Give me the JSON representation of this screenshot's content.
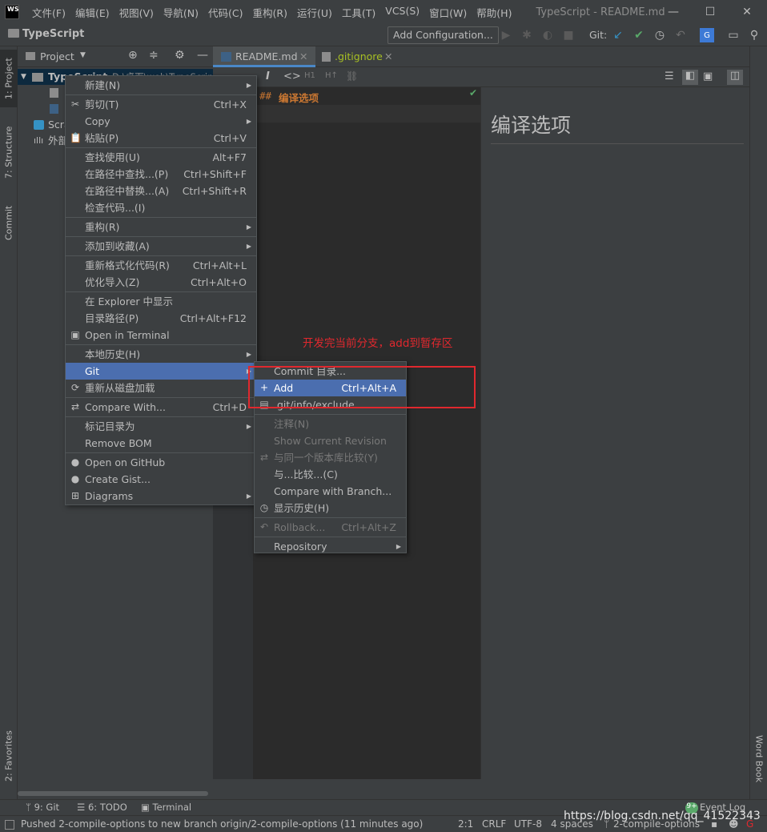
{
  "app": {
    "logo": "WS",
    "window_title": "TypeScript - README.md",
    "project_name": "TypeScript"
  },
  "menubar": [
    "文件(F)",
    "编辑(E)",
    "视图(V)",
    "导航(N)",
    "代码(C)",
    "重构(R)",
    "运行(U)",
    "工具(T)",
    "VCS(S)",
    "窗口(W)",
    "帮助(H)"
  ],
  "window_controls": {
    "minimize": "—",
    "maximize": "☐",
    "close": "✕"
  },
  "toolbar": {
    "add_configuration": "Add Configuration...",
    "git_label": "Git:"
  },
  "left_stripe": {
    "project": "1: Project",
    "structure": "7: Structure",
    "commit": "Commit",
    "favorites": "2: Favorites"
  },
  "right_stripe": {
    "word_book": "Word Book"
  },
  "project_panel": {
    "header": "Project",
    "root": "TypeScript",
    "root_path": "D:\\桌面\\web\\TypeScript",
    "scratches": "Scra",
    "external": "外部"
  },
  "tabs": [
    {
      "label": "README.md",
      "color": "#bbbbbb"
    },
    {
      "label": ".gitignore",
      "color": "#a8c023"
    }
  ],
  "editor": {
    "line1_hash": "##",
    "line1_text": "编译选项",
    "preview_title": "编译选项"
  },
  "context_menu": {
    "items": [
      {
        "label": "新建(N)",
        "shortcut": "",
        "submenu": true,
        "icon": ""
      },
      {
        "sep": true
      },
      {
        "label": "剪切(T)",
        "shortcut": "Ctrl+X",
        "icon": "✂"
      },
      {
        "label": "Copy",
        "shortcut": "",
        "submenu": true,
        "icon": ""
      },
      {
        "label": "粘贴(P)",
        "shortcut": "Ctrl+V",
        "icon": "📋"
      },
      {
        "sep": true
      },
      {
        "label": "查找使用(U)",
        "shortcut": "Alt+F7",
        "icon": ""
      },
      {
        "label": "在路径中查找...(P)",
        "shortcut": "Ctrl+Shift+F",
        "icon": ""
      },
      {
        "label": "在路径中替换...(A)",
        "shortcut": "Ctrl+Shift+R",
        "icon": ""
      },
      {
        "label": "检查代码...(I)",
        "shortcut": "",
        "icon": ""
      },
      {
        "sep": true
      },
      {
        "label": "重构(R)",
        "shortcut": "",
        "submenu": true,
        "icon": ""
      },
      {
        "sep": true
      },
      {
        "label": "添加到收藏(A)",
        "shortcut": "",
        "submenu": true,
        "icon": ""
      },
      {
        "sep": true
      },
      {
        "label": "重新格式化代码(R)",
        "shortcut": "Ctrl+Alt+L",
        "icon": ""
      },
      {
        "label": "优化导入(Z)",
        "shortcut": "Ctrl+Alt+O",
        "icon": ""
      },
      {
        "sep": true
      },
      {
        "label": "在 Explorer 中显示",
        "shortcut": "",
        "icon": ""
      },
      {
        "label": "目录路径(P)",
        "shortcut": "Ctrl+Alt+F12",
        "icon": ""
      },
      {
        "label": "Open in Terminal",
        "shortcut": "",
        "icon": "▣"
      },
      {
        "sep": true
      },
      {
        "label": "本地历史(H)",
        "shortcut": "",
        "submenu": true,
        "icon": ""
      },
      {
        "label": "Git",
        "shortcut": "",
        "submenu": true,
        "icon": "",
        "selected": true
      },
      {
        "label": "重新从磁盘加载",
        "shortcut": "",
        "icon": "⟳"
      },
      {
        "sep": true
      },
      {
        "label": "Compare With...",
        "shortcut": "Ctrl+D",
        "icon": "⇄"
      },
      {
        "sep": true
      },
      {
        "label": "标记目录为",
        "shortcut": "",
        "submenu": true,
        "icon": ""
      },
      {
        "label": "Remove BOM",
        "shortcut": "",
        "icon": ""
      },
      {
        "sep": true
      },
      {
        "label": "Open on GitHub",
        "shortcut": "",
        "icon": "●"
      },
      {
        "label": "Create Gist...",
        "shortcut": "",
        "icon": "●"
      },
      {
        "label": "Diagrams",
        "shortcut": "",
        "submenu": true,
        "icon": "⊞"
      }
    ]
  },
  "git_submenu": {
    "items": [
      {
        "label": "Commit 目录...",
        "shortcut": "",
        "icon": ""
      },
      {
        "label": "Add",
        "shortcut": "Ctrl+Alt+A",
        "icon": "+",
        "selected": true
      },
      {
        "label": ".git/info/exclude",
        "shortcut": "",
        "icon": "▤"
      },
      {
        "sep": true
      },
      {
        "label": "注释(N)",
        "shortcut": "",
        "icon": "",
        "disabled": true
      },
      {
        "label": "Show Current Revision",
        "shortcut": "",
        "icon": "",
        "disabled": true
      },
      {
        "label": "与同一个版本库比较(Y)",
        "shortcut": "",
        "icon": "⇄",
        "disabled": true
      },
      {
        "label": "与...比较...(C)",
        "shortcut": "",
        "icon": ""
      },
      {
        "label": "Compare with Branch...",
        "shortcut": "",
        "icon": ""
      },
      {
        "label": "显示历史(H)",
        "shortcut": "",
        "icon": "◷"
      },
      {
        "sep": true
      },
      {
        "label": "Rollback...",
        "shortcut": "Ctrl+Alt+Z",
        "icon": "↶",
        "disabled": true
      },
      {
        "sep": true
      },
      {
        "label": "Repository",
        "shortcut": "",
        "submenu": true,
        "icon": ""
      }
    ]
  },
  "annotation": "开发完当前分支，add到暂存区",
  "bottom_tools": {
    "git": "9: Git",
    "todo": "6: TODO",
    "terminal": "Terminal",
    "event_log": "Event Log",
    "event_badge": "9+"
  },
  "status": {
    "message": "Pushed 2-compile-options to new branch origin/2-compile-options (11 minutes ago)",
    "position": "2:1",
    "line_sep": "CRLF",
    "encoding": "UTF-8",
    "indent": "4 spaces",
    "branch": "2-compile-options"
  },
  "watermark": "https://blog.csdn.net/qq_41522343",
  "colors": {
    "accent": "#4b6eaf",
    "annotation": "#e0282e",
    "check": "#59a869",
    "bg": "#3c3f41",
    "editor_bg": "#2b2b2b"
  }
}
